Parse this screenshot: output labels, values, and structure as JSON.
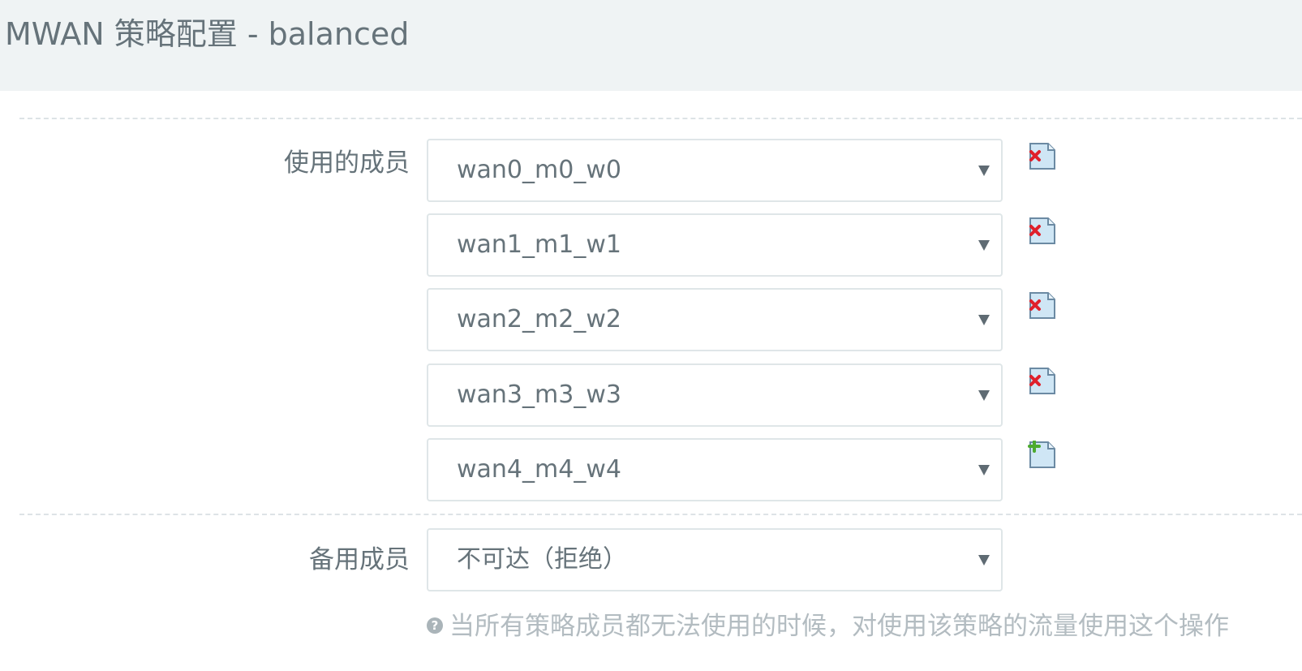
{
  "page": {
    "title": "MWAN 策略配置 - balanced"
  },
  "members_used": {
    "label": "使用的成员",
    "items": [
      {
        "value": "wan0_m0_w0",
        "action": "remove",
        "icon": "delete-icon"
      },
      {
        "value": "wan1_m1_w1",
        "action": "remove",
        "icon": "delete-icon"
      },
      {
        "value": "wan2_m2_w2",
        "action": "remove",
        "icon": "delete-icon"
      },
      {
        "value": "wan3_m3_w3",
        "action": "remove",
        "icon": "delete-icon"
      },
      {
        "value": "wan4_m4_w4",
        "action": "add",
        "icon": "add-icon"
      }
    ]
  },
  "fallback": {
    "label": "备用成员",
    "value": "不可达（拒绝）",
    "hint_icon": "question-circle-icon",
    "hint": "当所有策略成员都无法使用的时候，对使用该策略的流量使用这个操作"
  },
  "colors": {
    "header_bg": "#eff3f4",
    "text": "#66737a",
    "hint_text": "#b3bcc1",
    "border": "#dfe6e8",
    "delete_red": "#e0202b",
    "add_green": "#4caa2e",
    "doc_blue": "#cfe6f5"
  }
}
